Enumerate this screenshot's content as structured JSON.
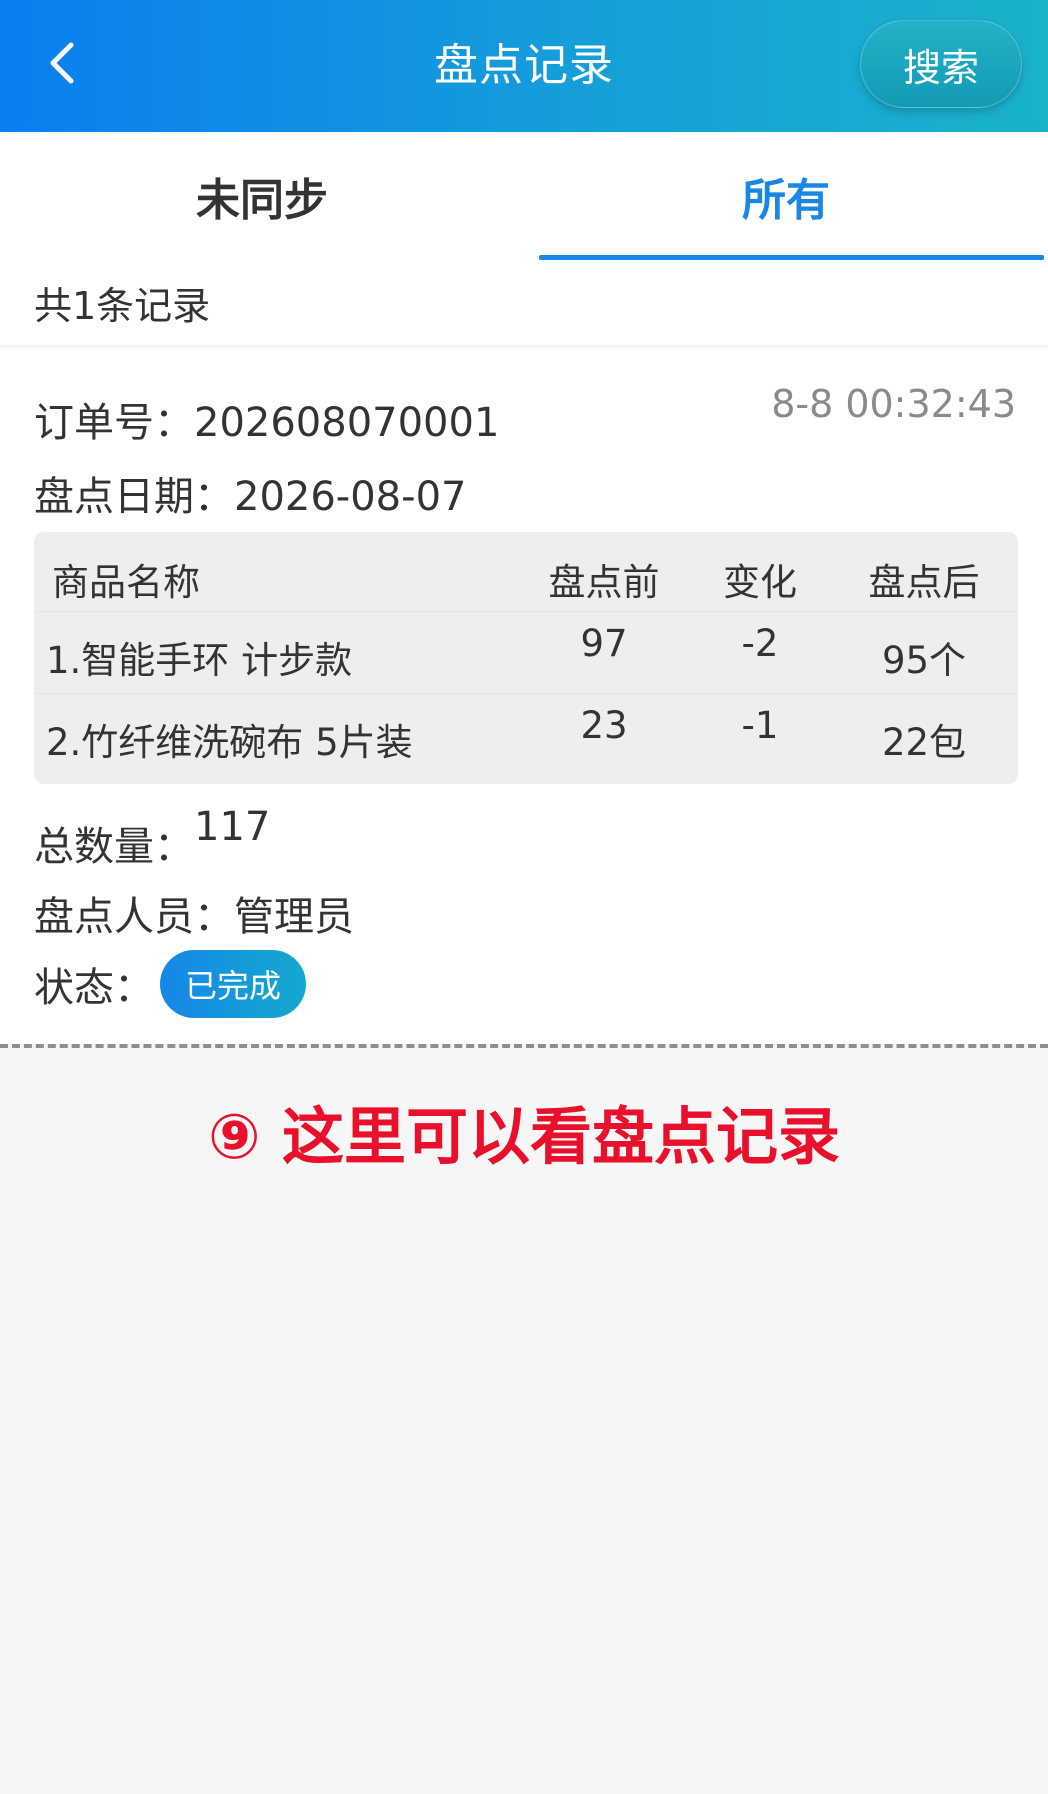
{
  "header": {
    "title": "盘点记录",
    "search_label": "搜索"
  },
  "tabs": [
    {
      "label": "未同步",
      "active": false
    },
    {
      "label": "所有",
      "active": true
    }
  ],
  "summary": {
    "count_text": "共1条记录"
  },
  "record": {
    "order_label": "订单号：",
    "order_no": "202608070001",
    "time": "8-8 00:32:43",
    "date_label": "盘点日期：",
    "date": "2026-08-07",
    "table": {
      "headers": [
        "商品名称",
        "盘点前",
        "变化",
        "盘点后"
      ],
      "rows": [
        [
          "1.智能手环 计步款",
          "97",
          "-2",
          "95个"
        ],
        [
          "2.竹纤维洗碗布 5片装",
          "23",
          "-1",
          "22包"
        ]
      ]
    },
    "total_label": "总数量：",
    "total": "117",
    "operator_label": "盘点人员：",
    "operator": "管理员",
    "status_label": "状态：",
    "status": "已完成"
  },
  "annotation": "⑨ 这里可以看盘点记录",
  "colors": {
    "header_gradient_start": "#0a7ef0",
    "header_gradient_end": "#19b2c9",
    "active_tab": "#1a86e6",
    "annotation": "#e8102b"
  },
  "icons": {
    "back": "chevron-left-icon"
  }
}
